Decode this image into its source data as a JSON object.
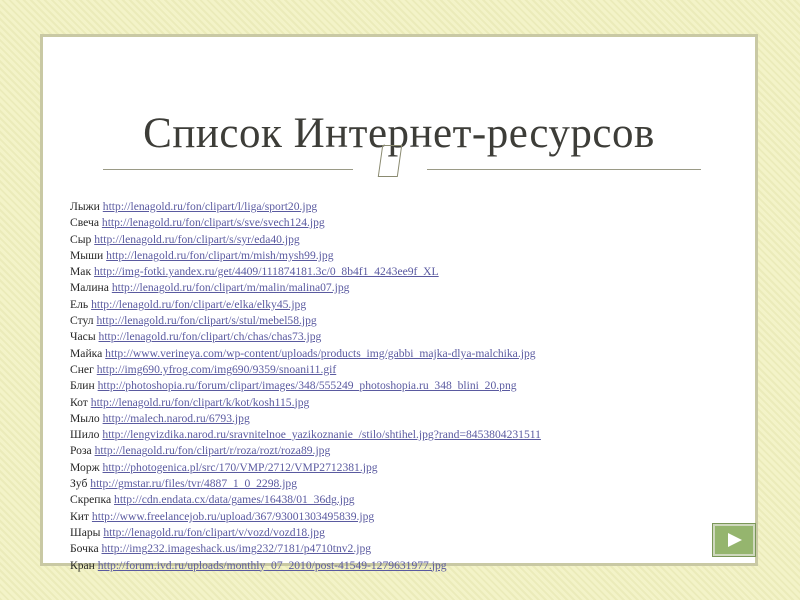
{
  "slide": {
    "title": "Список Интернет-ресурсов",
    "ornament_icon": "decorative-frame-icon"
  },
  "resources": [
    {
      "label": "Лыжи",
      "url": "http://lenagold.ru/fon/clipart/l/liga/sport20.jpg"
    },
    {
      "label": "Свеча",
      "url": "http://lenagold.ru/fon/clipart/s/sve/svech124.jpg"
    },
    {
      "label": "Сыр",
      "url": "http://lenagold.ru/fon/clipart/s/syr/eda40.jpg"
    },
    {
      "label": "Мыши",
      "url": "http://lenagold.ru/fon/clipart/m/mish/mysh99.jpg"
    },
    {
      "label": "Мак",
      "url": "http://img-fotki.yandex.ru/get/4409/111874181.3c/0_8b4f1_4243ee9f_XL"
    },
    {
      "label": "Малина",
      "url": "http://lenagold.ru/fon/clipart/m/malin/malina07.jpg"
    },
    {
      "label": "Ель",
      "url": "http://lenagold.ru/fon/clipart/e/elka/elky45.jpg"
    },
    {
      "label": "Стул",
      "url": "http://lenagold.ru/fon/clipart/s/stul/mebel58.jpg"
    },
    {
      "label": "Часы",
      "url": "http://lenagold.ru/fon/clipart/ch/chas/chas73.jpg"
    },
    {
      "label": "Майка",
      "url": "http://www.verineya.com/wp-content/uploads/products_img/gabbi_majka-dlya-malchika.jpg"
    },
    {
      "label": "Снег",
      "url": "http://img690.yfrog.com/img690/9359/snoani11.gif"
    },
    {
      "label": "Блин",
      "url": "http://photoshopia.ru/forum/clipart/images/348/555249_photoshopia.ru_348_blini_20.png"
    },
    {
      "label": "Кот",
      "url": "http://lenagold.ru/fon/clipart/k/kot/kosh115.jpg"
    },
    {
      "label": "Мыло",
      "url": "http://malech.narod.ru/6793.jpg"
    },
    {
      "label": "Шило",
      "url": "http://lengvizdika.narod.ru/sravnitelnoe_yazikoznanie_/stilo/shtihel.jpg?rand=8453804231511"
    },
    {
      "label": "Роза",
      "url": "http://lenagold.ru/fon/clipart/r/roza/rozt/roza89.jpg"
    },
    {
      "label": "Морж",
      "url": "http://photogenica.pl/src/170/VMP/2712/VMP2712381.jpg"
    },
    {
      "label": "Зуб",
      "url": "http://gmstar.ru/files/tvr/4887_1_0_2298.jpg"
    },
    {
      "label": "Скрепка",
      "url": "http://cdn.endata.cx/data/games/16438/01_36dg.jpg"
    },
    {
      "label": "Кит",
      "url": "http://www.freelancejob.ru/upload/367/93001303495839.jpg"
    },
    {
      "label": "Шары",
      "url": "http://lenagold.ru/fon/clipart/v/vozd/vozd18.jpg"
    },
    {
      "label": "Бочка",
      "url": "http://img232.imageshack.us/img232/7181/p4710tnv2.jpg"
    },
    {
      "label": "Кран",
      "url": "http://forum.ivd.ru/uploads/monthly_07_2010/post-41549-1279631977.jpg"
    }
  ],
  "navigation": {
    "next_icon": "next-slide-arrow-icon"
  },
  "colors": {
    "background": "#f3f3c8",
    "link": "#5a5aa0",
    "title": "#3d3d38",
    "nav_button": "#95b56e"
  }
}
